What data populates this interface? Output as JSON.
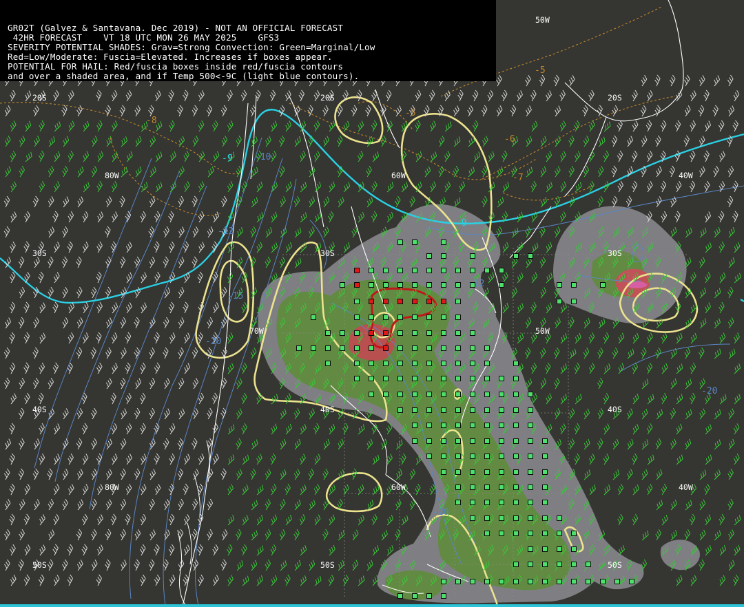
{
  "header": {
    "lines": [
      "GR02T (Galvez & Santavana. Dec 2019) - NOT AN OFFICIAL FORECAST",
      " 42HR FORECAST    VT 18 UTC MON 26 MAY 2025    GFS3",
      "SEVERITY POTENTIAL SHADES: Grav=Strong Convection: Green=Marginal/Low",
      "Red=Low/Moderate: Fuscia=Elevated. Increases if boxes appear.",
      "POTENTIAL FOR HAIL: Red/fuscia boxes inside red/fuscia contours",
      "and over a shaded area, and if Temp 500<-9C (light blue contours)."
    ]
  },
  "grid_labels": {
    "lat": [
      "20S",
      "20S",
      "20S",
      "30S",
      "30S",
      "30S",
      "40S",
      "40S",
      "40S",
      "50S",
      "50S",
      "50S"
    ],
    "lon": [
      "50W",
      "80W",
      "60W",
      "40W",
      "70W",
      "50W",
      "80W",
      "60W",
      "40W"
    ]
  },
  "contour_labels": {
    "temp_dashed": [
      "-5",
      "-5",
      "-6",
      "-7",
      "-8"
    ],
    "cyan": [
      "-9",
      "-9"
    ],
    "blue": [
      "-10",
      "-12",
      "-15",
      "-20",
      "-20",
      "-20",
      "-12"
    ]
  },
  "colors": {
    "background": "#353531",
    "coastline": "#ffffff",
    "severity_gray": "#8c8c92",
    "severity_green": "#5f8c3c",
    "severity_red": "#b85050",
    "severity_fuscia": "#d65fa4",
    "hail_box_green": "#4ee06c",
    "hail_box_red": "#e01818",
    "yellow_contour": "#ece38e",
    "cyan_contour": "#2ad0e4",
    "blue_contour": "#5a86c4",
    "orange_dashed": "#c2882e",
    "wind_barb_green": "#3ac83a",
    "wind_barb_white": "#d8d8d8"
  },
  "legend": {
    "severity_levels": [
      "Strong Convection",
      "Marginal/Low",
      "Low/Moderate",
      "Elevated"
    ]
  }
}
